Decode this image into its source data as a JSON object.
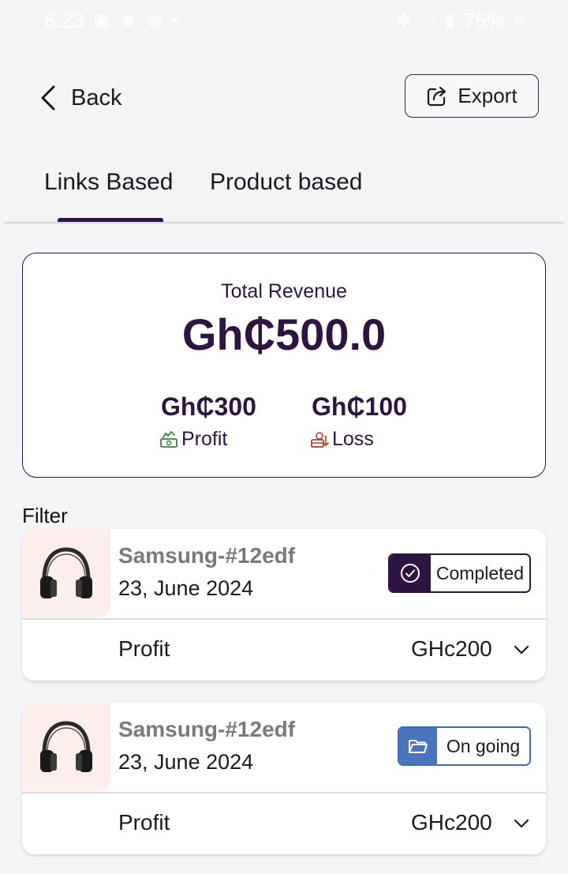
{
  "status_bar": {
    "time": "6:23",
    "battery": "75%"
  },
  "header": {
    "back_label": "Back",
    "export_label": "Export"
  },
  "tabs": [
    {
      "label": "Links Based",
      "active": true
    },
    {
      "label": "Product based",
      "active": false
    }
  ],
  "revenue": {
    "label": "Total Revenue",
    "value": "Gh₵500.0",
    "profit_amount": "Gh₵300",
    "profit_label": "Profit",
    "loss_amount": "Gh₵100",
    "loss_label": "Loss"
  },
  "filter_label": "Filter",
  "orders": [
    {
      "title": "Samsung-#12edf",
      "date": "23, June 2024",
      "status": "Completed",
      "row_label": "Profit",
      "row_value": "GHc200"
    },
    {
      "title": "Samsung-#12edf",
      "date": "23, June 2024",
      "status": "On going",
      "row_label": "Profit",
      "row_value": "GHc200"
    }
  ],
  "colors": {
    "primary": "#2e1440",
    "ongoing": "#4a74bc",
    "thumb_bg": "#fbeeeb",
    "background": "#f4f4f6"
  }
}
